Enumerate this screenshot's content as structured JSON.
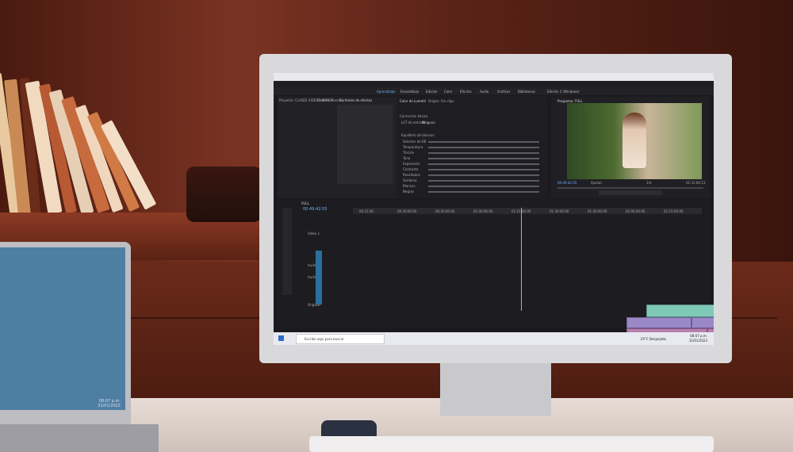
{
  "scene": {
    "description_kind": "photo"
  },
  "laptop": {
    "clock": "08:07 p.m.\n31/01/2023"
  },
  "premiere": {
    "workspaces": [
      "Aprendizaje",
      "Ensamblaje",
      "Edición",
      "Color",
      "Efectos",
      "Audio",
      "Gráficos",
      "Bibliotecas",
      "Edición 2 (Windows)"
    ],
    "active_workspace": "Aprendizaje",
    "source_tabs": [
      "Proyecto: CLASES VIDEOS BORIDA",
      "Rastreo: Fuente",
      "Controles de efectos"
    ],
    "lumetri_tab": "Color de Lumetri",
    "lumetri_sub": "Origen: Sin clips",
    "lumetri_section": "Corrección básica",
    "lumetri_lut_label": "LUT de entrada",
    "lumetri_lut_value": "Ninguno",
    "lumetri_wb": "Equilibrio de blancos",
    "lumetri_rows": [
      "Selector de EB",
      "Temperatura",
      "Tinción",
      "Tono",
      "Exposición",
      "Contraste",
      "Resaltados",
      "Sombras",
      "Blancos",
      "Negros"
    ],
    "program_title": "Programa: FULL",
    "program_timecode": "00:49:42:55",
    "program_fit": "Ajustar",
    "program_zoom": "1/4",
    "program_duration": "01:31:00:13",
    "sequence_tab": "FULL",
    "sequence_timecode": "00:49:42:55",
    "ruler_marks": [
      "00:15:00",
      "00:30:00:00",
      "00:45:00:00",
      "01:00:00:00",
      "01:15:00:00",
      "01:30:00:00",
      "01:45:00:00",
      "02:00:00:00",
      "02:15:00:00"
    ],
    "tracks": [
      "Vídeo 1",
      "Audio 1",
      "Audio 2",
      "Original"
    ]
  },
  "taskbar": {
    "search_placeholder": "Escribe aquí para buscar",
    "weather": "19°C Despejado",
    "time": "08:07 p.m.",
    "date": "31/01/2023"
  },
  "colors": {
    "accent": "#6cb0ff",
    "wall": "#5a2416",
    "desk": "#e8ddd6"
  }
}
